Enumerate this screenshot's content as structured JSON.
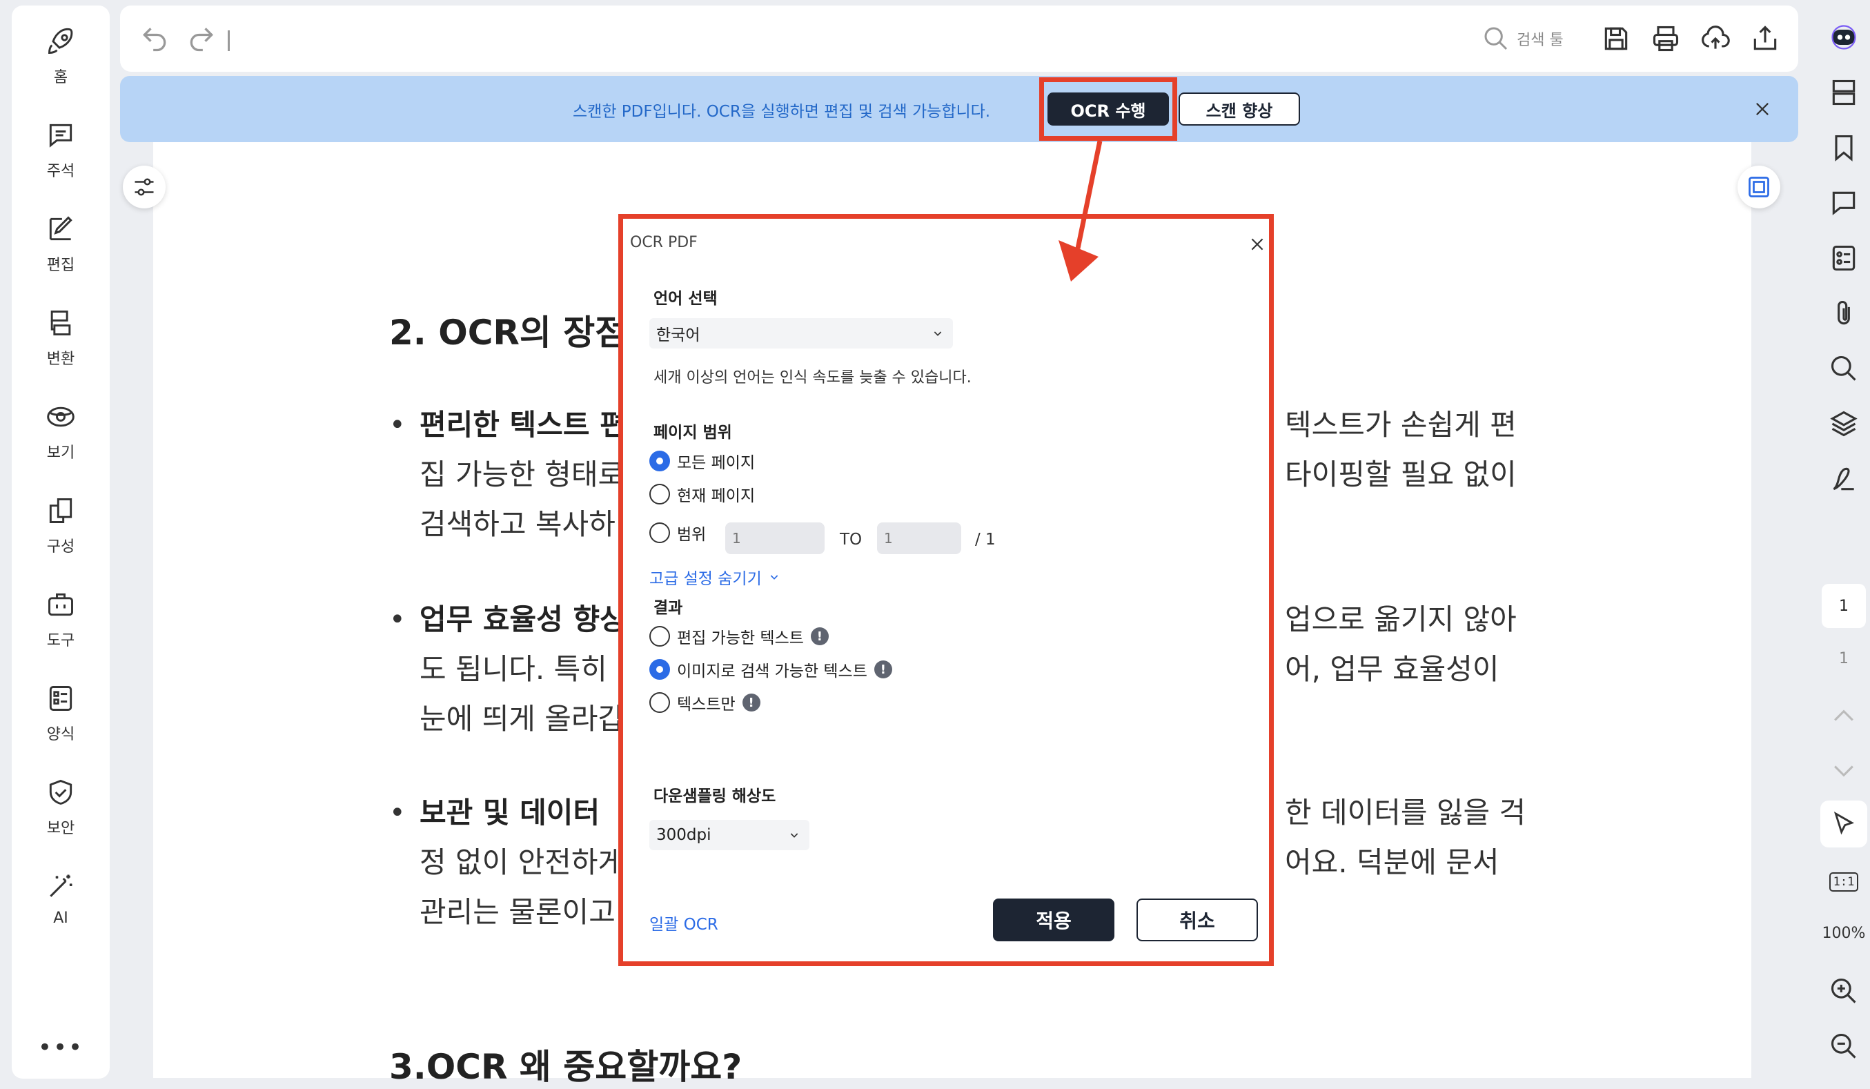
{
  "left_nav": {
    "items": [
      {
        "label": "홈",
        "icon": "rocket-icon"
      },
      {
        "label": "주석",
        "icon": "comment-icon"
      },
      {
        "label": "편집",
        "icon": "edit-icon"
      },
      {
        "label": "변환",
        "icon": "convert-icon"
      },
      {
        "label": "보기",
        "icon": "eye-icon"
      },
      {
        "label": "구성",
        "icon": "organize-icon"
      },
      {
        "label": "도구",
        "icon": "toolbox-icon"
      },
      {
        "label": "양식",
        "icon": "form-icon"
      },
      {
        "label": "보안",
        "icon": "shield-icon"
      },
      {
        "label": "AI",
        "icon": "magic-wand-icon"
      }
    ],
    "more": "•••"
  },
  "toolbar": {
    "search_placeholder": "검색 툴"
  },
  "banner": {
    "text": "스캔한 PDF입니다. OCR을 실행하면 편집 및 검색 가능합니다.",
    "ocr_button": "OCR 수행",
    "enhance_button": "스캔 향상"
  },
  "document": {
    "heading1": "2. OCR의 장점",
    "bullets": [
      {
        "bold": "편리한 텍스트 편",
        "line2": "집 가능한 형태로",
        "line3": "검색하고 복사하",
        "right1": "텍스트가 손쉽게 편",
        "right2": "타이핑할 필요 없이"
      },
      {
        "bold": "업무 효율성 향상",
        "line2": "도 됩니다. 특히",
        "line3": "눈에 띄게 올라갑",
        "right1": "업으로 옮기지 않아",
        "right2": "어, 업무 효율성이"
      },
      {
        "bold": "보관 및 데이터",
        "line2": "정 없이 안전하게",
        "line3": "관리는 물론이고",
        "right1": "한 데이터를 잃을 걱",
        "right2": "어요. 덕분에 문서"
      }
    ],
    "heading2": "3.OCR 왜 중요할까요?"
  },
  "dialog": {
    "title": "OCR PDF",
    "language_label": "언어 선택",
    "language_value": "한국어",
    "language_hint": "세개 이상의 언어는 인식 속도를 늦출 수 있습니다.",
    "page_range_label": "페이지 범위",
    "range_options": [
      "모든 페이지",
      "현재 페이지",
      "범위"
    ],
    "range_from_placeholder": "1",
    "range_to_label": "TO",
    "range_to_placeholder": "1",
    "range_total": "/ 1",
    "advanced_link": "고급 설정 숨기기",
    "result_label": "결과",
    "result_options": [
      "편집 가능한 텍스트",
      "이미지로 검색 가능한 텍스트",
      "텍스트만"
    ],
    "downsample_label": "다운샘플링 해상도",
    "downsample_value": "300dpi",
    "batch_link": "일괄 OCR",
    "apply_button": "적용",
    "cancel_button": "취소"
  },
  "right_panel": {
    "current_page": "1",
    "total_pages": "1",
    "zoom": "100%",
    "actual_size": "1:1"
  },
  "colors": {
    "accent": "#2b6be6",
    "banner_bg": "#b7d4f6",
    "highlight": "#e5402a",
    "dark_button": "#1d2533"
  }
}
